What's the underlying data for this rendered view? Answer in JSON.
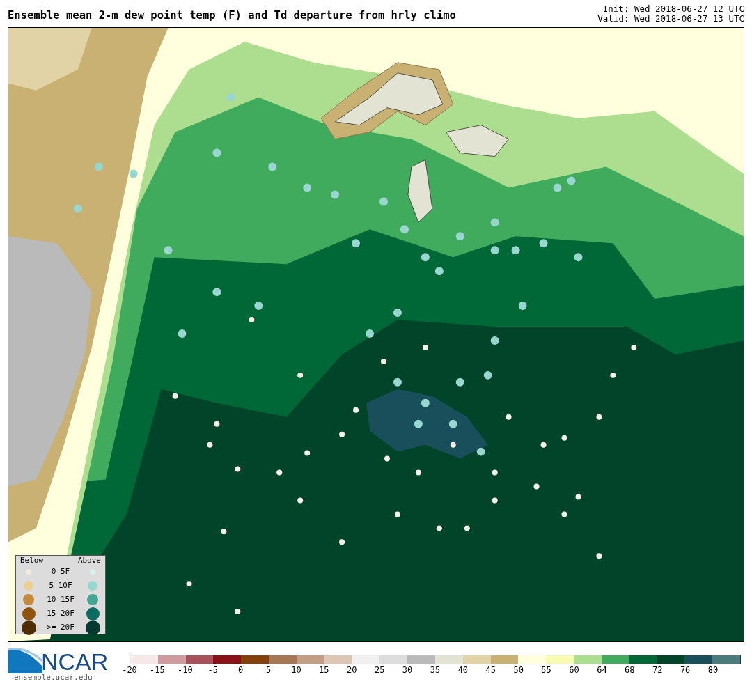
{
  "header": {
    "title": "Ensemble mean 2-m dew point temp (F) and Td departure from hrly climo",
    "init": "Init: Wed 2018-06-27 12 UTC",
    "valid": "Valid: Wed 2018-06-27 13 UTC"
  },
  "legend": {
    "below_header": "Below",
    "above_header": "Above",
    "rows": [
      {
        "label": "0-5F",
        "below": {
          "color": "#f3ebd9"
        },
        "above": {
          "color": "#d9efec"
        }
      },
      {
        "label": "5-10F",
        "below": {
          "color": "#ebcf92"
        },
        "above": {
          "color": "#94d8cf"
        }
      },
      {
        "label": "10-15F",
        "below": {
          "color": "#c48a3c"
        },
        "above": {
          "color": "#45a596"
        }
      },
      {
        "label": "15-20F",
        "below": {
          "color": "#8f530f"
        },
        "above": {
          "color": "#0c6c62"
        }
      },
      {
        "label": ">= 20F",
        "below": {
          "color": "#4e2d05"
        },
        "above": {
          "color": "#053a30"
        }
      }
    ]
  },
  "logo": {
    "name": "NCAR",
    "url": "ensemble.ucar.edu"
  },
  "colorbar": [
    {
      "color": "#f6e8e8",
      "label": "-20"
    },
    {
      "color": "#cf9b9e",
      "label": "-15"
    },
    {
      "color": "#a9515a",
      "label": "-10"
    },
    {
      "color": "#8b1119",
      "label": "-5"
    },
    {
      "color": "#84410c",
      "label": "0"
    },
    {
      "color": "#a67753",
      "label": "5"
    },
    {
      "color": "#c39e84",
      "label": "10"
    },
    {
      "color": "#dec6b4",
      "label": "15"
    },
    {
      "color": "#f0f0f0",
      "label": "20"
    },
    {
      "color": "#dddddd",
      "label": "25"
    },
    {
      "color": "#bababa",
      "label": "30"
    },
    {
      "color": "#e3e3d3",
      "label": "35"
    },
    {
      "color": "#e2d3a7",
      "label": "40"
    },
    {
      "color": "#c8b173",
      "label": "45"
    },
    {
      "color": "#ffffdd",
      "label": "50"
    },
    {
      "color": "#f7fcb0",
      "label": "55"
    },
    {
      "color": "#addd8e",
      "label": "60"
    },
    {
      "color": "#41ab5d",
      "label": "64"
    },
    {
      "color": "#006837",
      "label": "68"
    },
    {
      "color": "#004529",
      "label": "72"
    },
    {
      "color": "#194f5a",
      "label": "76"
    },
    {
      "color": "#4a7a7c",
      "label": "80"
    }
  ]
}
